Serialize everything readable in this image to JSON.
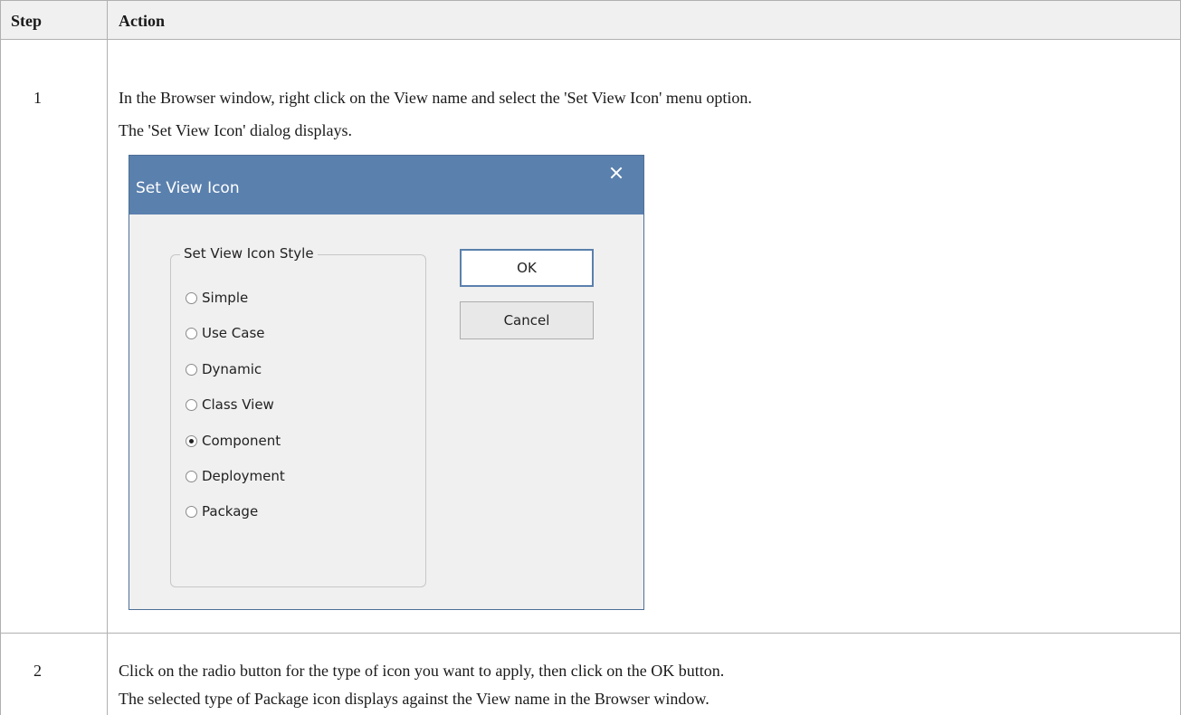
{
  "table": {
    "headers": {
      "step": "Step",
      "action": "Action"
    },
    "rows": [
      {
        "step": "1",
        "lines": [
          "In the Browser window, right click on the View name and select the 'Set View Icon' menu option.",
          "The 'Set View Icon' dialog displays."
        ]
      },
      {
        "step": "2",
        "lines": [
          "Click on the radio button for the type of icon you want to apply, then click on the OK button.",
          "The selected type of Package icon displays against the View name in the Browser window."
        ]
      }
    ]
  },
  "dialog": {
    "title": "Set View Icon",
    "close_icon": "close-icon",
    "group_label": "Set View Icon Style",
    "options": [
      {
        "label": "Simple",
        "checked": false
      },
      {
        "label": "Use Case",
        "checked": false
      },
      {
        "label": "Dynamic",
        "checked": false
      },
      {
        "label": "Class View",
        "checked": false
      },
      {
        "label": "Component",
        "checked": true
      },
      {
        "label": "Deployment",
        "checked": false
      },
      {
        "label": "Package",
        "checked": false
      }
    ],
    "ok_label": "OK",
    "cancel_label": "Cancel",
    "colors": {
      "titlebar": "#5a80ad",
      "title_text": "#ffffff",
      "background": "#f0f0f0"
    }
  }
}
